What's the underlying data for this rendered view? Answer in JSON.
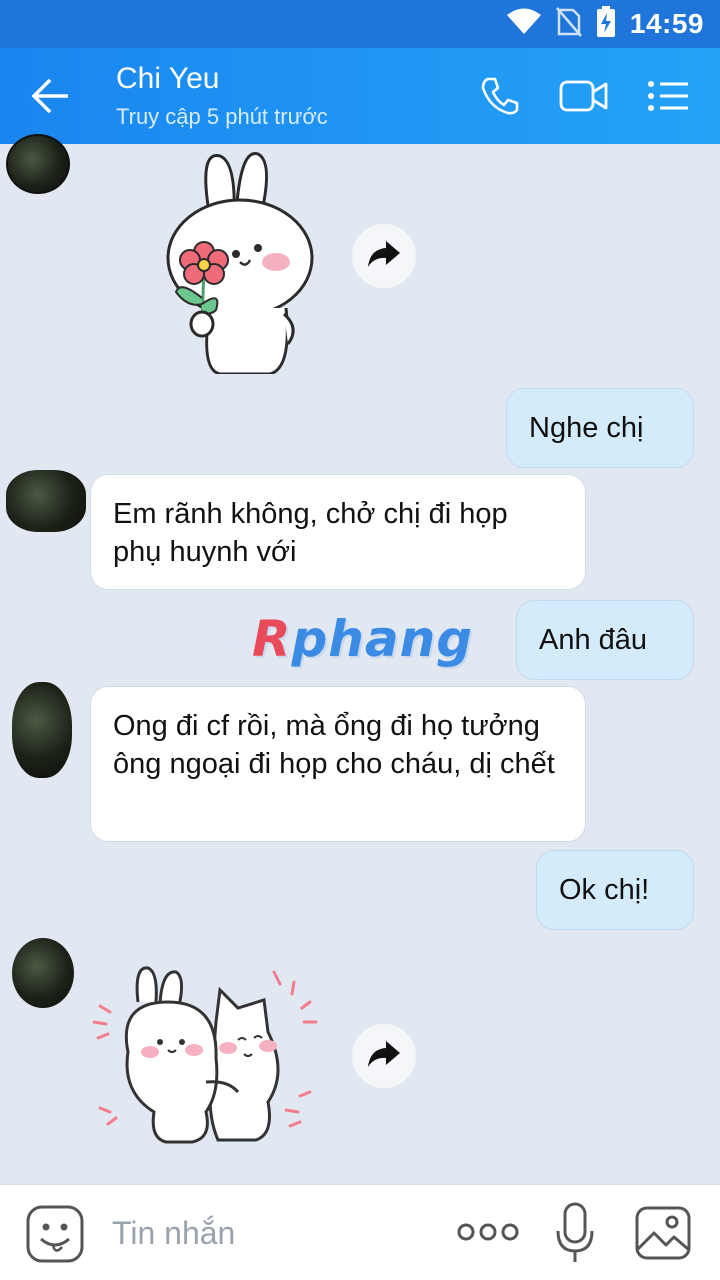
{
  "status_bar": {
    "time": "14:59",
    "icons": [
      "wifi-icon",
      "no-sim-icon",
      "battery-charging-icon"
    ]
  },
  "header": {
    "back_icon": "arrow-left-icon",
    "contact_name": "Chi Yeu",
    "contact_status": "Truy cập 5 phút trước",
    "actions": [
      "phone-icon",
      "video-call-icon",
      "menu-list-icon"
    ]
  },
  "messages": [
    {
      "type": "sticker",
      "direction": "in",
      "sticker": "bunny-with-flower"
    },
    {
      "type": "text",
      "direction": "out",
      "text": "Nghe chị"
    },
    {
      "type": "text",
      "direction": "in",
      "text": "Em rãnh không, chở chị đi họp phụ huynh với"
    },
    {
      "type": "text",
      "direction": "out",
      "text": "Anh đâu"
    },
    {
      "type": "text",
      "direction": "in",
      "text": "Ong đi cf rồi, mà ổng đi họ tưởng ông ngoại đi họp cho cháu, dị chết"
    },
    {
      "type": "text",
      "direction": "out",
      "text": "Ok chị!"
    },
    {
      "type": "sticker",
      "direction": "in",
      "sticker": "bunny-and-cat-hug"
    }
  ],
  "watermark": {
    "first": "R",
    "rest": "phang"
  },
  "input_bar": {
    "placeholder": "Tin nhắn",
    "icons": [
      "emoji-sticker-icon",
      "more-dots-icon",
      "microphone-icon",
      "image-gallery-icon"
    ]
  },
  "colors": {
    "status_bar": "#1f75d9",
    "header_start": "#1a86f0",
    "header_end": "#24a3f7",
    "chat_bg": "#e2e8f1",
    "bubble_in": "#ffffff",
    "bubble_out": "#d4ebfb"
  }
}
